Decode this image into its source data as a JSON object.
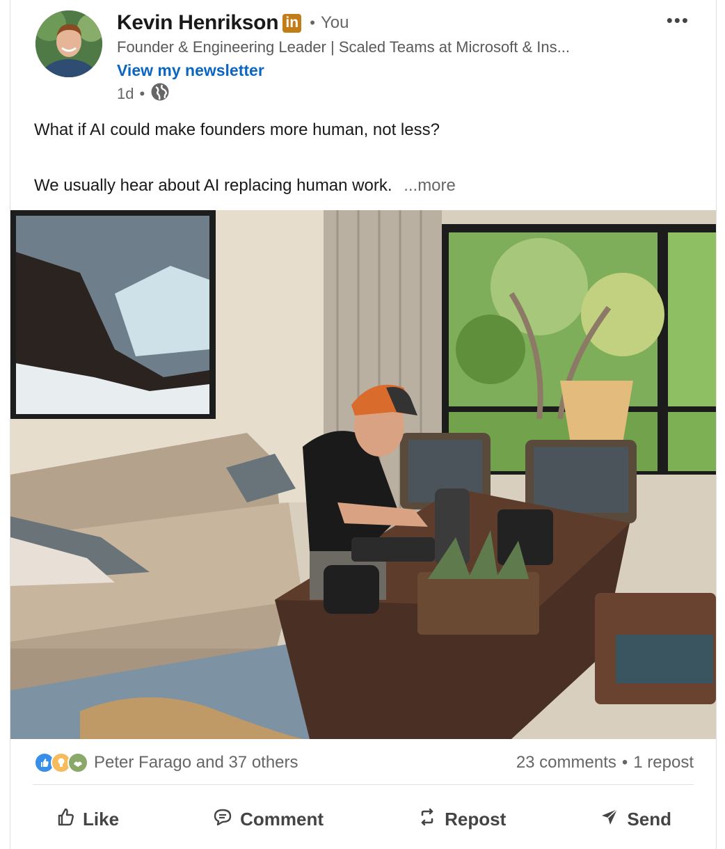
{
  "author": {
    "name": "Kevin Henrikson",
    "badge_text": "in",
    "relation": "You",
    "headline": "Founder & Engineering Leader | Scaled Teams at Microsoft & Ins...",
    "newsletter_link": "View my newsletter",
    "time_ago": "1d",
    "visibility_icon": "globe-icon"
  },
  "menu_label": "•••",
  "post": {
    "line1": "What if AI could make founders more human, not less?",
    "line2": "We usually hear about AI replacing human work.",
    "see_more": "...more"
  },
  "social": {
    "reactions": [
      "like-icon",
      "insightful-icon",
      "support-icon"
    ],
    "reactors_text": "Peter Farago and 37 others",
    "comments_text": "23 comments",
    "reposts_text": "1 repost"
  },
  "actions": {
    "like": "Like",
    "comment": "Comment",
    "repost": "Repost",
    "send": "Send"
  },
  "colors": {
    "link_blue": "#0a66c2",
    "badge_orange": "#c37d16",
    "text_secondary": "#666666"
  }
}
